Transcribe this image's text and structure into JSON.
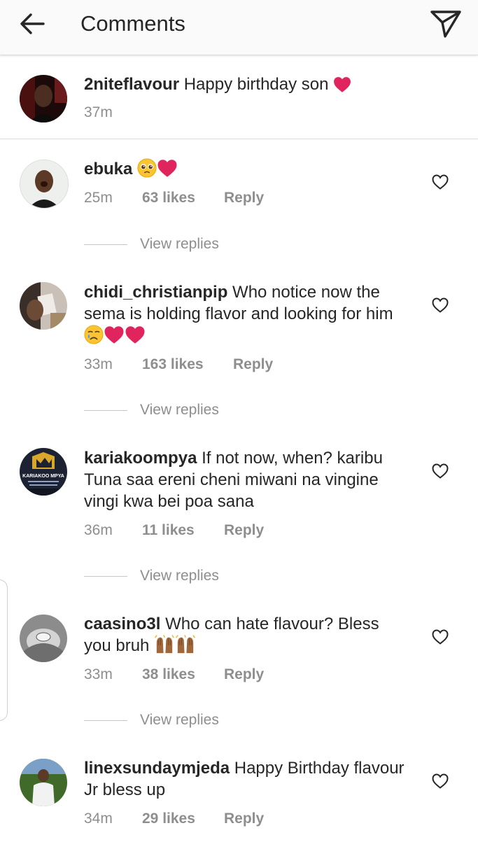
{
  "header": {
    "title": "Comments"
  },
  "caption": {
    "username": "2niteflavour",
    "text": " Happy birthday son ",
    "time": "37m"
  },
  "comments": [
    {
      "username": "ebuka",
      "text": " ",
      "time": "25m",
      "likes": "63 likes",
      "reply": "Reply",
      "view_replies": "View replies"
    },
    {
      "username": "chidi_christianpip",
      "text": " Who notice now the sema  is holding flavor and looking for him ",
      "time": "33m",
      "likes": "163 likes",
      "reply": "Reply",
      "view_replies": "View replies"
    },
    {
      "username": "kariakoompya",
      "text": " If not now, when? karibu Tuna saa ereni cheni miwani na vingine vingi kwa bei poa sana",
      "time": "36m",
      "likes": "11 likes",
      "reply": "Reply",
      "view_replies": "View replies"
    },
    {
      "username": "caasino3l",
      "text": " Who can hate flavour?  Bless you bruh ",
      "time": "33m",
      "likes": "38 likes",
      "reply": "Reply",
      "view_replies": "View replies"
    },
    {
      "username": "linexsundaymjeda",
      "text": " Happy Birthday flavour Jr bless up",
      "time": "34m",
      "likes": "29 likes",
      "reply": "Reply"
    }
  ],
  "avatar_logo_text": "KARIAKOO MPYA",
  "colors": {
    "heart_red": "#e0245e",
    "muted_text": "#8e8e8e",
    "text": "#262626",
    "header_bg": "#fafafa"
  },
  "icons": [
    "back-arrow-icon",
    "send-icon",
    "heart-outline-icon",
    "red-heart-emoji",
    "pleading-face-emoji",
    "crying-face-emoji",
    "raised-hands-emoji"
  ]
}
